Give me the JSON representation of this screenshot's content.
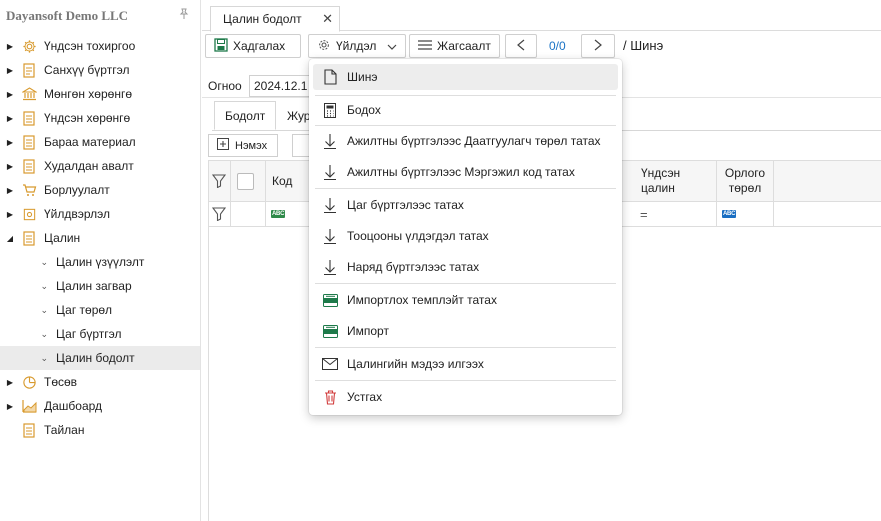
{
  "company": {
    "name": "Dayansoft Demo LLC"
  },
  "sidebar": {
    "items": [
      {
        "label": "Үндсэн тохиргоо",
        "icon": "gear-icon",
        "arrow": "▶"
      },
      {
        "label": "Санхүү бүртгэл",
        "icon": "ledger-icon",
        "arrow": "▶"
      },
      {
        "label": "Мөнгөн хөрөнгө",
        "icon": "bank-icon",
        "arrow": "▶"
      },
      {
        "label": "Үндсэн хөрөнгө",
        "icon": "asset-icon",
        "arrow": "▶"
      },
      {
        "label": "Бараа материал",
        "icon": "inventory-icon",
        "arrow": "▶"
      },
      {
        "label": "Худалдан авалт",
        "icon": "purchase-icon",
        "arrow": "▶"
      },
      {
        "label": "Борлуулалт",
        "icon": "cart-icon",
        "arrow": "▶"
      },
      {
        "label": "Үйлдвэрлэл",
        "icon": "factory-icon",
        "arrow": "▶"
      },
      {
        "label": "Цалин",
        "icon": "payroll-icon",
        "arrow": "◢"
      },
      {
        "label": "Цалин үзүүлэлт",
        "sub": true
      },
      {
        "label": "Цалин загвар",
        "sub": true
      },
      {
        "label": "Цаг төрөл",
        "sub": true
      },
      {
        "label": "Цаг бүртгэл",
        "sub": true
      },
      {
        "label": "Цалин бодолт",
        "sub": true,
        "active": true
      },
      {
        "label": "Төсөв",
        "icon": "pie-chart-icon",
        "arrow": "▶"
      },
      {
        "label": "Дашбоард",
        "icon": "dashboard-icon",
        "arrow": "▶"
      },
      {
        "label": "Тайлан",
        "icon": "report-icon",
        "arrow": ""
      }
    ]
  },
  "tab": {
    "label": "Цалин бодолт",
    "close": "✕"
  },
  "toolbar": {
    "save_label": "Хадгалах",
    "action_label": "Үйлдэл",
    "list_label": "Жагсаалт",
    "pager": "0/0",
    "prev": "<",
    "next": ">",
    "breadcrumb": "/ Шинэ"
  },
  "form": {
    "date_label": "Огноо",
    "date_value": "2024.12.1"
  },
  "subtabs": [
    {
      "label": "Бодолт",
      "active": true
    },
    {
      "label": "Жур"
    }
  ],
  "grid": {
    "add_label": "Нэмэх",
    "columns": [
      "Код",
      "Үндсэн цалин",
      "Орлого төрөл"
    ],
    "filter_eq": "="
  },
  "menu": {
    "items": [
      {
        "label": "Шинэ",
        "icon": "new-document-icon",
        "highlight": true
      },
      {
        "label": "Бодох",
        "icon": "calculator-icon"
      },
      {
        "label": "Ажилтны бүртгэлээс Даатгуулагч төрөл татах",
        "icon": "download-arrow-icon"
      },
      {
        "label": "Ажилтны бүртгэлээс Мэргэжил код татах",
        "icon": "download-arrow-icon"
      },
      {
        "label": "Цаг бүртгэлээс татах",
        "icon": "download-arrow-icon"
      },
      {
        "label": "Тооцооны үлдэгдэл татах",
        "icon": "download-arrow-icon"
      },
      {
        "label": "Наряд бүртгэлээс татах",
        "icon": "download-arrow-icon"
      },
      {
        "label": "Импортлох темплэйт татах",
        "icon": "excel-icon"
      },
      {
        "label": "Импорт",
        "icon": "excel-icon"
      },
      {
        "label": "Цалингийн мэдээ илгээх",
        "icon": "envelope-icon"
      },
      {
        "label": "Устгах",
        "icon": "trash-icon"
      }
    ]
  },
  "colors": {
    "accent": "#1a73c5",
    "icon_orange": "#d89a2e",
    "excel_green": "#1e7a4a",
    "trash_red": "#d23c3c"
  }
}
